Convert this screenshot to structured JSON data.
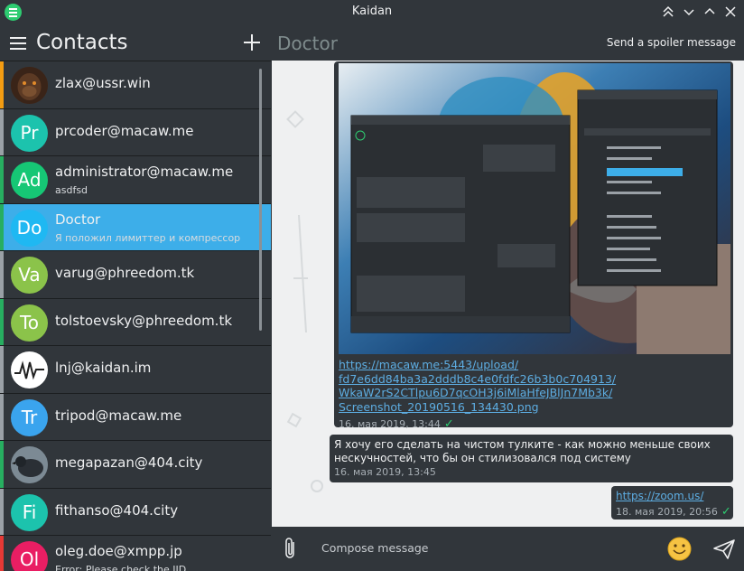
{
  "window": {
    "title": "Kaidan",
    "app_icon": "kaidan-logo-icon",
    "controls": [
      "keep-above-icon",
      "minimize-icon",
      "maximize-icon",
      "close-icon"
    ]
  },
  "sidebar": {
    "title": "Contacts",
    "menu_icon": "hamburger-icon",
    "add_icon": "plus-icon",
    "contacts": [
      {
        "name": "zlax@ussr.win",
        "status": "",
        "initials": "",
        "avatar": "photo-gorilla",
        "bar_color": "#f39c12",
        "avatar_color": "#4a3022"
      },
      {
        "name": "prcoder@macaw.me",
        "status": "",
        "initials": "Pr",
        "avatar": "initials",
        "bar_color": "#9aa0a6",
        "avatar_color": "#1cc3ad"
      },
      {
        "name": "administrator@macaw.me",
        "status": "asdfsd",
        "initials": "Ad",
        "avatar": "initials",
        "bar_color": "#27ae60",
        "avatar_color": "#16c775"
      },
      {
        "name": "Doctor",
        "status": "Я положил лимиттер и компрессор",
        "initials": "Do",
        "avatar": "initials",
        "bar_color": "#27ae60",
        "avatar_color": "#1fb8f2"
      },
      {
        "name": "varug@phreedom.tk",
        "status": "",
        "initials": "Va",
        "avatar": "initials",
        "bar_color": "#9aa0a6",
        "avatar_color": "#8bc34a"
      },
      {
        "name": "tolstoevsky@phreedom.tk",
        "status": "",
        "initials": "To",
        "avatar": "initials",
        "bar_color": "#27ae60",
        "avatar_color": "#8bc34a"
      },
      {
        "name": "lnj@kaidan.im",
        "status": "",
        "initials": "",
        "avatar": "logo-waveform",
        "bar_color": "#9aa0a6",
        "avatar_color": "#ffffff"
      },
      {
        "name": "tripod@macaw.me",
        "status": "",
        "initials": "Tr",
        "avatar": "initials",
        "bar_color": "#9aa0a6",
        "avatar_color": "#3aa4ee"
      },
      {
        "name": "megapazan@404.city",
        "status": "",
        "initials": "",
        "avatar": "photo-bird",
        "bar_color": "#27ae60",
        "avatar_color": "#4a5560"
      },
      {
        "name": "fithanso@404.city",
        "status": "",
        "initials": "Fi",
        "avatar": "initials",
        "bar_color": "#9aa0a6",
        "avatar_color": "#1cc3ad"
      },
      {
        "name": "oleg.doe@xmpp.jp",
        "status": "Error: Please check the JID",
        "initials": "Ol",
        "avatar": "initials",
        "bar_color": "#e53935",
        "avatar_color": "#e91e63"
      }
    ]
  },
  "chat": {
    "title": "Doctor",
    "spoiler_button": "Send a spoiler message",
    "messages": [
      {
        "type": "image",
        "image": "screenshot-parrot-kaidan",
        "link_lines": [
          "https://macaw.me:5443/upload/",
          "fd7e6dd84ba3a2dddb8c4e0fdfc26b3b0c704913/",
          "WkaW2rS2CTlpu6D7qcOH3j6iMlaHfeJBlJn7Mb3k/",
          "Screenshot_20190516_134430.png"
        ],
        "time": "16. мая 2019, 13:44",
        "check": "✓"
      },
      {
        "type": "text",
        "text": "Я хочу его сделать на чистом тулките - как можно меньше своих нескучностей, что бы он стилизовался под систему",
        "time": "16. мая 2019, 13:45"
      },
      {
        "type": "link",
        "link": "https://zoom.us/",
        "time": "18. мая 2019, 20:56",
        "check": "✓"
      }
    ],
    "composer": {
      "placeholder": "Compose message",
      "attach_icon": "paperclip-icon",
      "emoji_icon": "smiley-icon",
      "send_icon": "send-icon"
    }
  }
}
